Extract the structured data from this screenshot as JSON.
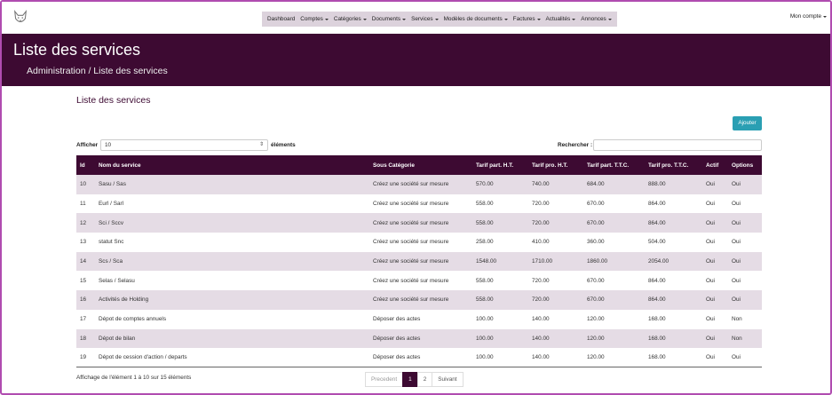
{
  "nav": {
    "menu": [
      {
        "label": "Dashboard",
        "dropdown": false
      },
      {
        "label": "Comptes",
        "dropdown": true
      },
      {
        "label": "Catégories",
        "dropdown": true
      },
      {
        "label": "Documents",
        "dropdown": true
      },
      {
        "label": "Services",
        "dropdown": true
      },
      {
        "label": "Modèles de documents",
        "dropdown": true
      },
      {
        "label": "Factures",
        "dropdown": true
      },
      {
        "label": "Actualités",
        "dropdown": true
      },
      {
        "label": "Annonces",
        "dropdown": true
      }
    ],
    "account_label": "Mon compte"
  },
  "header": {
    "title": "Liste des services",
    "breadcrumb": "Administration / Liste des services"
  },
  "content": {
    "section_title": "Liste des services",
    "add_button": "Ajouter",
    "length_label": "Afficher",
    "length_value": "10",
    "length_suffix": "éléments",
    "search_label": "Rechercher :",
    "search_value": ""
  },
  "table": {
    "columns": [
      "Id",
      "Nom du service",
      "Sous Catégorie",
      "Tarif part. H.T.",
      "Tarif pro. H.T.",
      "Tarif part. T.T.C.",
      "Tarif pro. T.T.C.",
      "Actif",
      "Options"
    ],
    "rows": [
      [
        "10",
        "Sasu / Sas",
        "Créez une société sur mesure",
        "570.00",
        "740.00",
        "684.00",
        "888.00",
        "Oui",
        "Oui"
      ],
      [
        "11",
        "Eurl / Sarl",
        "Créez une société sur mesure",
        "558.00",
        "720.00",
        "670.00",
        "864.00",
        "Oui",
        "Oui"
      ],
      [
        "12",
        "Sci / Sccv",
        "Créez une société sur mesure",
        "558.00",
        "720.00",
        "670.00",
        "864.00",
        "Oui",
        "Oui"
      ],
      [
        "13",
        "statut Snc",
        "Créez une société sur mesure",
        "258.00",
        "410.00",
        "360.00",
        "504.00",
        "Oui",
        "Oui"
      ],
      [
        "14",
        "Scs / Sca",
        "Créez une société sur mesure",
        "1548.00",
        "1710.00",
        "1860.00",
        "2054.00",
        "Oui",
        "Oui"
      ],
      [
        "15",
        "Selas / Selasu",
        "Créez une société sur mesure",
        "558.00",
        "720.00",
        "670.00",
        "864.00",
        "Oui",
        "Oui"
      ],
      [
        "16",
        "Activités de Holding",
        "Créez une société sur mesure",
        "558.00",
        "720.00",
        "670.00",
        "864.00",
        "Oui",
        "Oui"
      ],
      [
        "17",
        "Dépot de comptes annuels",
        "Déposer des actes",
        "100.00",
        "140.00",
        "120.00",
        "168.00",
        "Oui",
        "Non"
      ],
      [
        "18",
        "Dépot de bilan",
        "Déposer des actes",
        "100.00",
        "140.00",
        "120.00",
        "168.00",
        "Oui",
        "Non"
      ],
      [
        "19",
        "Dépot de cession d'action / departs",
        "Déposer des actes",
        "100.00",
        "140.00",
        "120.00",
        "168.00",
        "Oui",
        "Oui"
      ]
    ]
  },
  "footer": {
    "info": "Affichage de l'élément 1 à 10 sur 15 éléments",
    "prev": "Precedent",
    "pages": [
      "1",
      "2"
    ],
    "next": "Suivant"
  },
  "colors": {
    "brand": "#3d0a32",
    "row_stripe": "#e5dce5",
    "button": "#2a9fb3",
    "frame": "#b04cb0"
  }
}
